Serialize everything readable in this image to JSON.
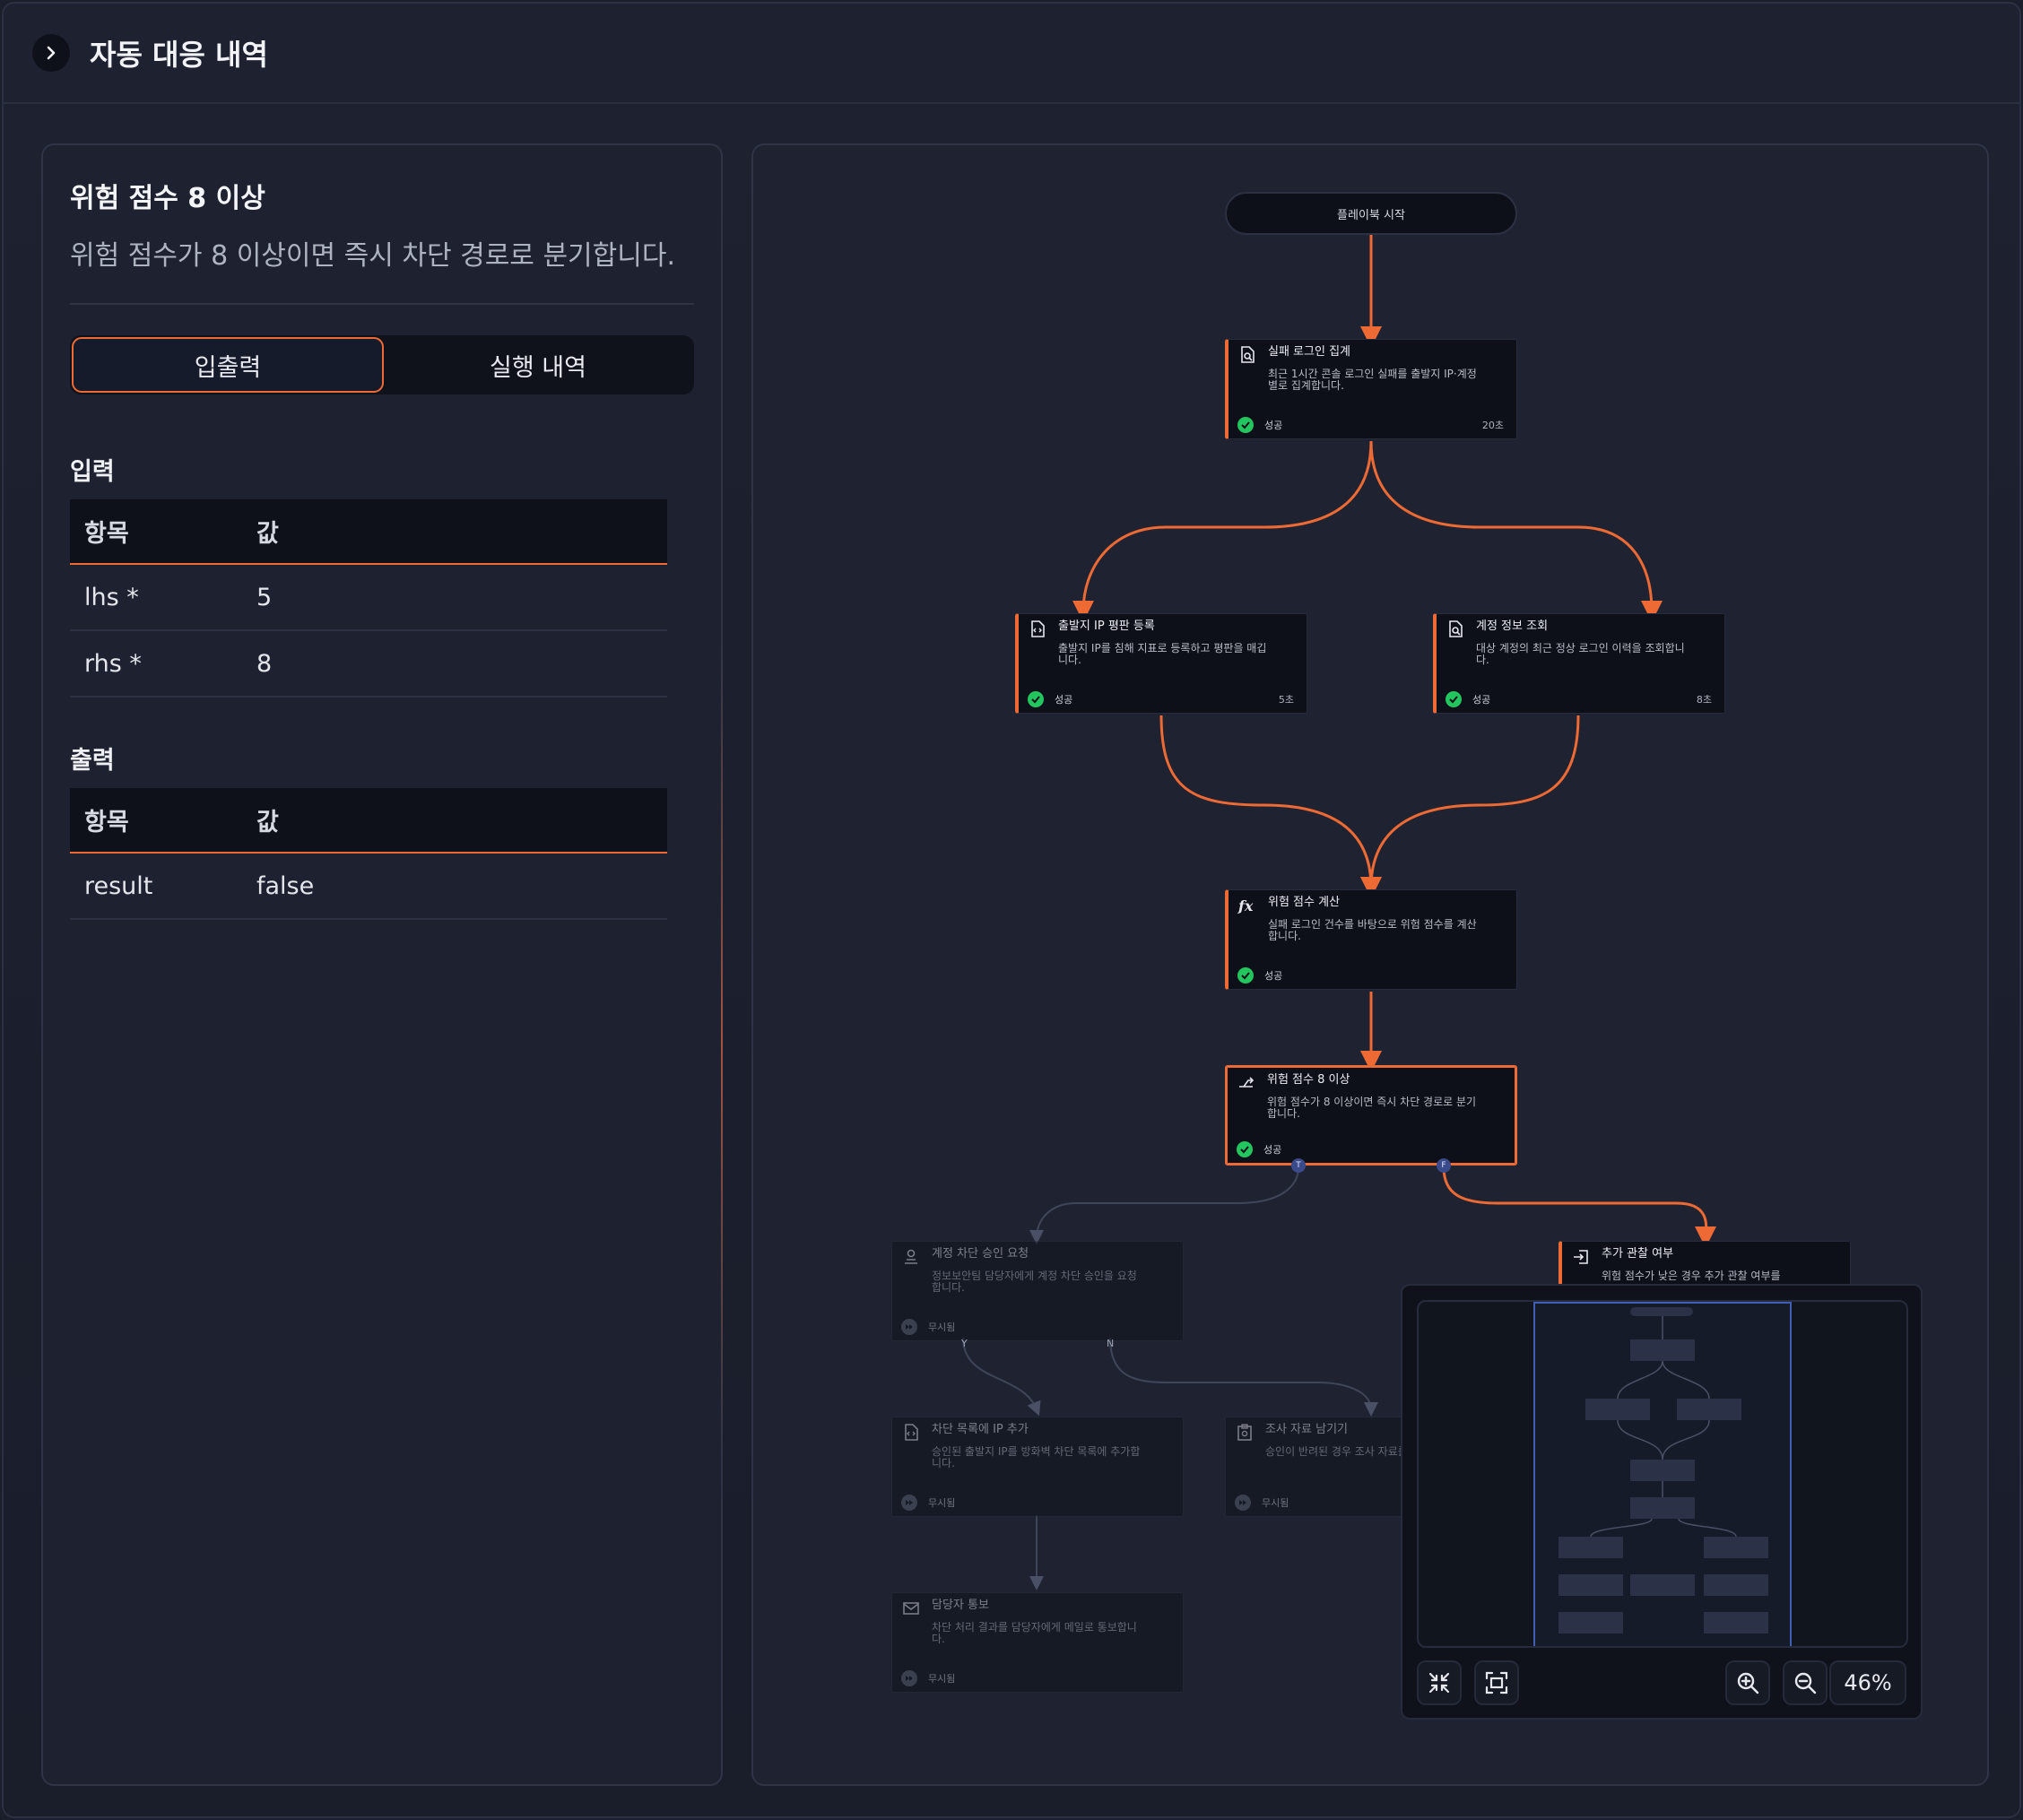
{
  "header": {
    "title": "자동 대응 내역"
  },
  "detail": {
    "title": "위험 점수 8 이상",
    "description": "위험 점수가 8 이상이면 즉시 차단 경로로 분기합니다.",
    "tabs": [
      {
        "label": "입출력",
        "active": true
      },
      {
        "label": "실행 내역",
        "active": false
      }
    ],
    "input": {
      "label": "입력",
      "columns": [
        "항목",
        "값"
      ],
      "rows": [
        [
          "lhs *",
          "5"
        ],
        [
          "rhs *",
          "8"
        ]
      ]
    },
    "output": {
      "label": "출력",
      "columns": [
        "항목",
        "값"
      ],
      "rows": [
        [
          "result",
          "false"
        ]
      ]
    }
  },
  "flow": {
    "start_label": "플레이북 시작",
    "nodes": [
      {
        "id": "n1",
        "icon": "document-search-icon",
        "title": "실패 로그인 집계",
        "description": "최근 1시간 콘솔 로그인 실패를 출발지 IP·계정별로 집계합니다.",
        "status": "성공",
        "time": "20초",
        "state": "success"
      },
      {
        "id": "n2",
        "icon": "document-code-icon",
        "title": "출발지 IP 평판 등록",
        "description": "출발지 IP를 침해 지표로 등록하고 평판을 매깁니다.",
        "status": "성공",
        "time": "5초",
        "state": "success"
      },
      {
        "id": "n3",
        "icon": "document-search-icon",
        "title": "계정 정보 조회",
        "description": "대상 계정의 최근 정상 로그인 이력을 조회합니다.",
        "status": "성공",
        "time": "8초",
        "state": "success"
      },
      {
        "id": "n4",
        "icon": "function-icon",
        "title": "위험 점수 계산",
        "description": "실패 로그인 건수를 바탕으로 위험 점수를 계산합니다.",
        "status": "성공",
        "time": "",
        "state": "success"
      },
      {
        "id": "n5",
        "icon": "branch-icon",
        "title": "위험 점수 8 이상",
        "description": "위험 점수가 8 이상이면 즉시 차단 경로로 분기합니다.",
        "status": "성공",
        "time": "",
        "state": "selected"
      },
      {
        "id": "n6",
        "icon": "user-approval-icon",
        "title": "계정 차단 승인 요청",
        "description": "정보보안팀 담당자에게 계정 차단 승인을 요청합니다.",
        "status": "무시됨",
        "time": "",
        "state": "skipped"
      },
      {
        "id": "n7",
        "icon": "enter-icon",
        "title": "추가 관찰 여부",
        "description": "위험 점수가 낮은 경우 추가 관찰 여부를",
        "status": "",
        "time": "",
        "state": "success"
      },
      {
        "id": "n8",
        "icon": "document-code-icon",
        "title": "차단 목록에 IP 추가",
        "description": "승인된 출발지 IP를 방화벽 차단 목록에 추가합니다.",
        "status": "무시됨",
        "time": "",
        "state": "skipped"
      },
      {
        "id": "n9",
        "icon": "clipboard-search-icon",
        "title": "조사 자료 남기기",
        "description": "승인이 반려된 경우 조사 자료를 남깁니다.",
        "status": "무시됨",
        "time": "",
        "state": "skipped"
      },
      {
        "id": "n10",
        "icon": "mail-icon",
        "title": "담당자 통보",
        "description": "차단 처리 결과를 담당자에게 메일로 통보합니다.",
        "status": "무시됨",
        "time": "",
        "state": "skipped"
      }
    ],
    "ports": {
      "true": "T",
      "false": "F",
      "yes": "Y",
      "no": "N"
    }
  },
  "minimap": {
    "zoom": "46%"
  },
  "colors": {
    "accent": "#ee6a34",
    "success": "#22c55e",
    "port": "#3a4a8a"
  }
}
